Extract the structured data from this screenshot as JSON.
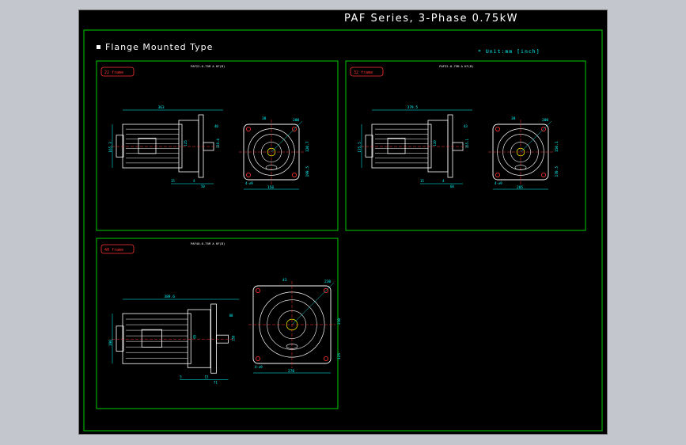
{
  "drawing": {
    "title": "PAF Series, 3-Phase 0.75kW",
    "section_label": "Flange Mounted Type",
    "unit_note": "* Unit:mm [inch]"
  },
  "colors": {
    "background": "#000000",
    "frame": "#00cc00",
    "outline": "#ffffff",
    "dimension": "#00ffff",
    "centerline": "#ff3333",
    "tag": "#ff3333",
    "hatch": "#ffff00",
    "title": "#ffffff",
    "note": "#00ffff"
  },
  "views": [
    {
      "tag": "22 frame",
      "model": "PAF22-0.75M A KF(B)",
      "dims": {
        "length": "363",
        "height_side": "165.3",
        "flange": "130.4",
        "small": "15",
        "d1": "4",
        "d2": "50",
        "d3": "125",
        "shaft": "40",
        "n1": "120.7",
        "n2": "180",
        "dia": "200",
        "bolt": "4-⌀9",
        "w1": "156",
        "w2": "199.5",
        "p1": "38"
      }
    },
    {
      "tag": "32 frame",
      "model": "PAF32-0.75M A KF(B)",
      "dims": {
        "length": "379.5",
        "height_side": "175.5",
        "flange": "155.1",
        "small": "15",
        "d1": "4",
        "d2": "60",
        "d3": "130",
        "shaft": "43",
        "n1": "150.1",
        "n2": "165",
        "dia": "200",
        "bolt": "4-⌀9",
        "w1": "205",
        "w2": "170.5",
        "p1": "38"
      }
    },
    {
      "tag": "40 frame",
      "model": "PAF40-0.75M A KF(B)",
      "dims": {
        "length": "389.6",
        "height_side": "190",
        "flange": "150",
        "small": "5",
        "d1": "15",
        "d2": "71",
        "d3": "65",
        "shaft": "80",
        "n1": "210",
        "n2": "180",
        "dia": "230",
        "bolt": "4-⌀9",
        "w1": "270",
        "w2": "125",
        "p1": "43"
      }
    }
  ]
}
